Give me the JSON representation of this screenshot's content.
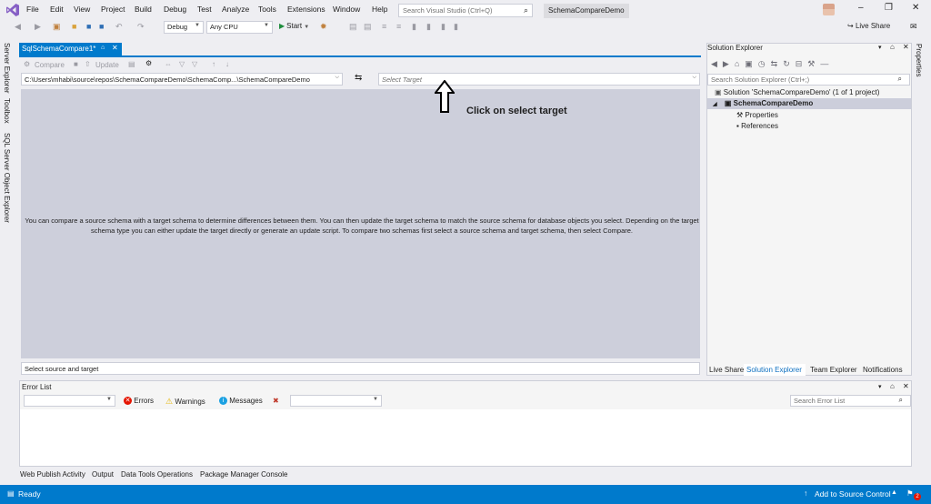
{
  "menu": [
    "File",
    "Edit",
    "View",
    "Project",
    "Build",
    "Debug",
    "Test",
    "Analyze",
    "Tools",
    "Extensions",
    "Window",
    "Help"
  ],
  "search_vs": {
    "placeholder": "Search Visual Studio (Ctrl+Q)"
  },
  "solution_title": "SchemaCompareDemo",
  "live_share": "Live Share",
  "toolbar": {
    "config": "Debug",
    "platform": "Any CPU",
    "start": "Start"
  },
  "left_tabs": [
    "Server Explorer",
    "Toolbox",
    "SQL Server Object Explorer"
  ],
  "document": {
    "tab_label": "SqlSchemaCompare1*",
    "compare_label": "Compare",
    "update_label": "Update",
    "source_path": "C:\\Users\\mhabi\\source\\repos\\SchemaCompareDemo\\SchemaComp...\\SchemaCompareDemo",
    "target_placeholder": "Select Target",
    "info_text": "You can compare a source schema with a target schema to determine differences between them.  You can then update the target schema to match the source schema for database objects you select.  Depending on the target schema type you can either update the target directly or generate an update script.  To compare two schemas first select a source schema and target schema, then select Compare.",
    "status": "Select source and target"
  },
  "annotation": {
    "text": "Click on select target"
  },
  "solution_explorer": {
    "title": "Solution Explorer",
    "search_placeholder": "Search Solution Explorer (Ctrl+;)",
    "solution": "Solution 'SchemaCompareDemo' (1 of 1 project)",
    "project": "SchemaCompareDemo",
    "items": [
      "Properties",
      "References"
    ],
    "tabs": [
      "Live Share",
      "Solution Explorer",
      "Team Explorer",
      "Notifications"
    ]
  },
  "properties_tab": "Properties",
  "error_list": {
    "title": "Error List",
    "errors": "Errors",
    "warnings": "Warnings",
    "messages": "Messages",
    "search_placeholder": "Search Error List"
  },
  "bottom_tabs": [
    "Web Publish Activity",
    "Output",
    "Data Tools Operations",
    "Package Manager Console"
  ],
  "statusbar": {
    "ready": "Ready",
    "source_control": "Add to Source Control",
    "notifications_count": "2"
  },
  "colors": {
    "accent": "#007acc",
    "panel": "#eeeef2",
    "compare_area": "#cdcfdb"
  }
}
